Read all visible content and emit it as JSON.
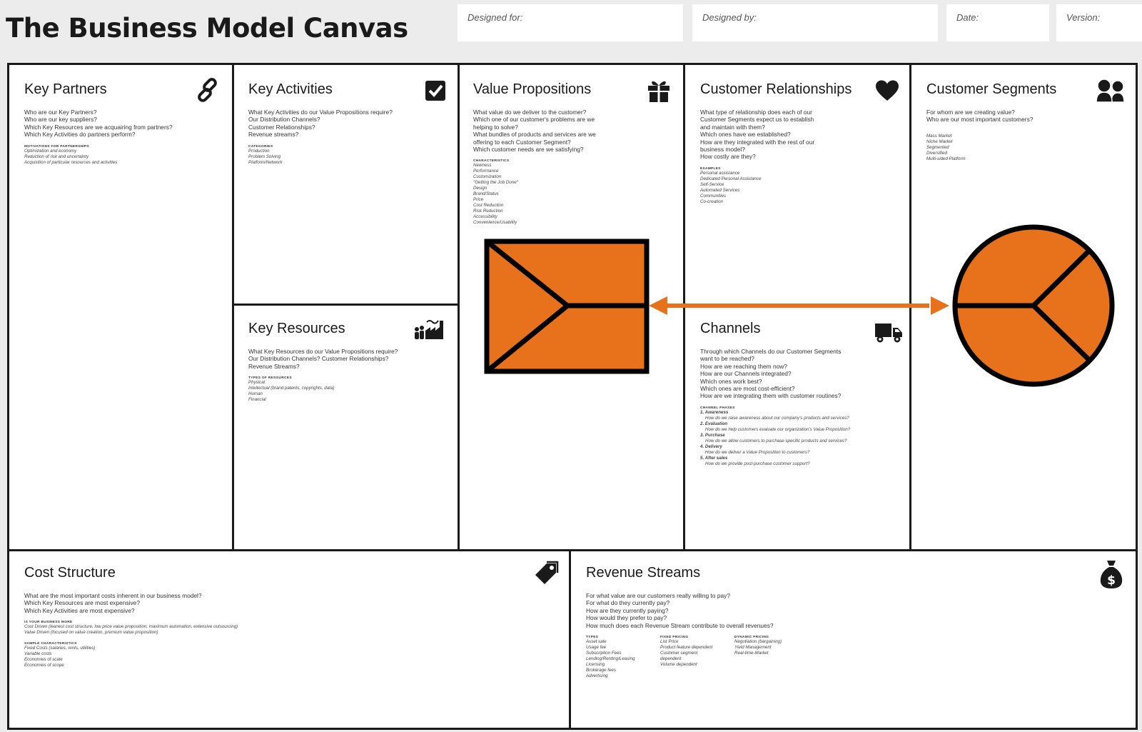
{
  "header": {
    "title": "The Business Model Canvas",
    "designed_for": "Designed for:",
    "designed_by": "Designed by:",
    "date": "Date:",
    "version": "Version:"
  },
  "colors": {
    "accent": "#e8711b",
    "ink": "#1a1a1a",
    "background": "#ececed"
  },
  "blocks": {
    "key_partners": {
      "title": "Key Partners",
      "icon": "link-icon",
      "questions": [
        "Who are our Key Partners?",
        "Who are our key suppliers?",
        "Which Key Resources are we acquairing from partners?",
        "Which Key Activities do partners perform?"
      ],
      "sub": "MOTIVATIONS FOR PARTNERSHIPS",
      "items": [
        "Optimization and economy",
        "Reduction of risk and uncertainty",
        "Acquisition of particular resources and activities"
      ]
    },
    "key_activities": {
      "title": "Key Activities",
      "icon": "checkbox-icon",
      "questions": [
        "What Key Activities do our Value Propositions require?",
        "Our Distribution Channels?",
        "Customer Relationships?",
        "Revenue streams?"
      ],
      "sub": "CATEGORIES",
      "items": [
        "Production",
        "Problem Solving",
        "Platform/Network"
      ]
    },
    "key_resources": {
      "title": "Key Resources",
      "icon": "factory-icon",
      "questions": [
        "What Key Resources do our Value Propositions require?",
        "Our Distribution Channels? Customer Relationships?",
        "Revenue Streams?"
      ],
      "sub": "TYPES OF RESOURCES",
      "items": [
        "Physical",
        "Intellectual (brand patents, copyrights, data)",
        "Human",
        "Financial"
      ]
    },
    "value_propositions": {
      "title": "Value Propositions",
      "icon": "gift-icon",
      "questions": [
        "What value do we deliver to the customer?",
        "Which one of our customer's problems are we",
        "helping to solve?",
        "What bundles of products and services are we",
        "offering to each Customer Segment?",
        "Which customer needs are we satisfying?"
      ],
      "sub": "CHARACTERISTICS",
      "items": [
        "Newness",
        "Performance",
        "Customization",
        "\"Getting the Job Done\"",
        "Design",
        "Brand/Status",
        "Price",
        "Cost Reduction",
        "Risk Reduction",
        "Accessibility",
        "Convenience/Usability"
      ]
    },
    "customer_relationships": {
      "title": "Customer Relationships",
      "icon": "heart-icon",
      "questions": [
        "What type of relationship does each of our",
        "Customer Segments expect us to establish",
        "and maintain with them?",
        "Which ones have we established?",
        "How are they integrated with the rest of our",
        "business model?",
        "How costly are they?"
      ],
      "sub": "EXAMPLES",
      "items": [
        "Personal assistance",
        "Dedicated Personal Assistance",
        "Self-Service",
        "Automated Services",
        "Communities",
        "Co-creation"
      ]
    },
    "channels": {
      "title": "Channels",
      "icon": "truck-icon",
      "questions": [
        "Through which Channels do our Customer Segments",
        "want to be reached?",
        "How are we reaching them now?",
        "How are our Channels integrated?",
        "Which ones work best?",
        "Which ones are most cost-efficient?",
        "How are we integrating them with customer routines?"
      ],
      "sub": "CHANNEL PHASES",
      "phases": [
        {
          "name": "1. Awareness",
          "detail": "How do we raise awareness about our company's products and services?"
        },
        {
          "name": "2. Evaluation",
          "detail": "How do we help customers evaluate our organization's Value Proposition?"
        },
        {
          "name": "3. Purchase",
          "detail": "How do we allow customers to purchase specific products and services?"
        },
        {
          "name": "4. Delivery",
          "detail": "How do we deliver a Value Proposition to customers?"
        },
        {
          "name": "5. After sales",
          "detail": "How do we provide post-purchase customer support?"
        }
      ]
    },
    "customer_segments": {
      "title": "Customer Segments",
      "icon": "people-icon",
      "questions": [
        "For whom are we creating value?",
        "Who are our most important customers?"
      ],
      "items": [
        "Mass Market",
        "Niche Market",
        "Segmented",
        "Diversified",
        "Multi-sided Platform"
      ]
    },
    "cost_structure": {
      "title": "Cost Structure",
      "icon": "price-tag-icon",
      "questions": [
        "What are the most important costs inherent in our business model?",
        "Which Key Resources are most expensive?",
        "Which Key Activities are most expensive?"
      ],
      "sub1": "IS YOUR BUSINESS MORE",
      "items1": [
        "Cost Driven (leanest cost structure, low price value proposition, maximum automation, extensive outsourcing)",
        "Value Driven (focused on value creation, premium value proposition)"
      ],
      "sub2": "SAMPLE CHARACTERISTICS",
      "items2": [
        "Fixed Costs (salaries, rents, utilities)",
        "Variable costs",
        "Economies of scale",
        "Economies of scope"
      ]
    },
    "revenue_streams": {
      "title": "Revenue Streams",
      "icon": "money-bag-icon",
      "questions": [
        "For what value are our customers really willing to pay?",
        "For what do they currently pay?",
        "How are they currently paying?",
        "How would they prefer to pay?",
        "How much does each Revenue Stream contribute to overall revenues?"
      ],
      "columns": [
        {
          "sub": "TYPES",
          "items": [
            "Asset sale",
            "Usage fee",
            "Subscription Fees",
            "Lending/Renting/Leasing",
            "Licensing",
            "Brokerage fees",
            "Advertising"
          ]
        },
        {
          "sub": "FIXED PRICING",
          "items": [
            "List Price",
            "Product feature dependent",
            "Customer segment",
            "dependent",
            "Volume dependent"
          ]
        },
        {
          "sub": "DYNAMIC PRICING",
          "items": [
            "Negotiation (bargaining)",
            "Yield Management",
            "Real-time-Market"
          ]
        }
      ]
    }
  }
}
